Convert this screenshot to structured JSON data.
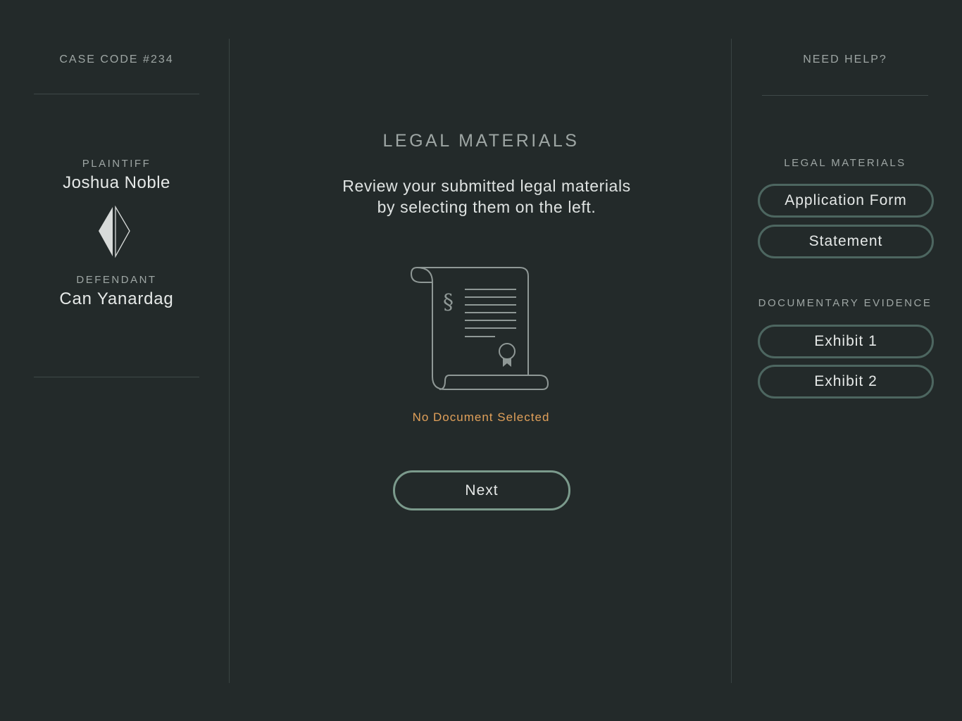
{
  "case": {
    "code_label": "CASE CODE #234"
  },
  "parties": {
    "plaintiff_label": "PLAINTIFF",
    "plaintiff_name": "Joshua Noble",
    "defendant_label": "DEFENDANT",
    "defendant_name": "Can Yanardag",
    "emblem_icon": "split-diamond-icon"
  },
  "main": {
    "title": "LEGAL MATERIALS",
    "description_line1": "Review your submitted legal materials",
    "description_line2": "by selecting them on the left.",
    "illustration_icon": "legal-scroll-icon",
    "section_glyph": "§",
    "status": "No Document Selected",
    "next_label": "Next"
  },
  "sidebar": {
    "help_label": "NEED HELP?",
    "legal_materials_label": "LEGAL MATERIALS",
    "legal_materials": [
      {
        "label": "Application Form"
      },
      {
        "label": "Statement"
      }
    ],
    "documentary_evidence_label": "DOCUMENTARY EVIDENCE",
    "documentary_evidence": [
      {
        "label": "Exhibit 1"
      },
      {
        "label": "Exhibit 2"
      }
    ]
  },
  "colors": {
    "background": "#232a2a",
    "accent": "#e0a05a",
    "primary_button_border": "#7b9a8c",
    "pill_border": "#4d6660",
    "muted_text": "#9ea6a4"
  }
}
